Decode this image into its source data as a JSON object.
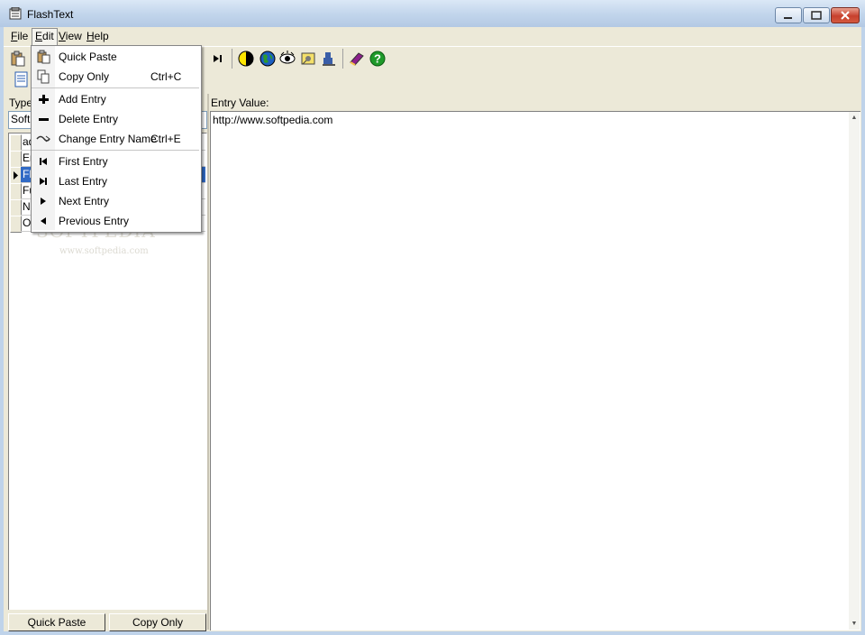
{
  "window": {
    "title": "FlashText"
  },
  "menubar": [
    {
      "label": "File",
      "key": "F",
      "rest": "ile"
    },
    {
      "label": "Edit",
      "key": "E",
      "rest": "dit"
    },
    {
      "label": "View",
      "key": "V",
      "rest": "iew"
    },
    {
      "label": "Help",
      "key": "H",
      "rest": "elp"
    }
  ],
  "edit_menu": {
    "items": [
      {
        "label": "Quick Paste",
        "shortcut": "",
        "icon": "clipboard-icon"
      },
      {
        "label": "Copy Only",
        "shortcut": "Ctrl+C",
        "icon": "copy-icon"
      },
      {
        "label": "Add Entry",
        "shortcut": "",
        "icon": "plus-icon"
      },
      {
        "label": "Delete Entry",
        "shortcut": "",
        "icon": "minus-icon"
      },
      {
        "label": "Change Entry Name",
        "shortcut": "Ctrl+E",
        "icon": "rename-icon"
      },
      {
        "label": "First Entry",
        "shortcut": "",
        "icon": "first-icon"
      },
      {
        "label": "Last Entry",
        "shortcut": "",
        "icon": "last-icon"
      },
      {
        "label": "Next Entry",
        "shortcut": "",
        "icon": "next-icon"
      },
      {
        "label": "Previous Entry",
        "shortcut": "",
        "icon": "previous-icon"
      }
    ]
  },
  "left_panel": {
    "type_label": "Type",
    "type_value": "Softp",
    "rows": [
      "ad",
      "Er",
      "Fl",
      "Fu",
      "N",
      "O"
    ],
    "quick_paste_button": "Quick Paste",
    "copy_only_button": "Copy Only"
  },
  "right_panel": {
    "label": "Entry Value:",
    "value": "http://www.softpedia.com"
  },
  "watermark": {
    "text": "SOFTPEDIA",
    "url": "www.softpedia.com"
  },
  "colors": {
    "selection": "#316ac5",
    "chrome": "#ece9d8"
  }
}
